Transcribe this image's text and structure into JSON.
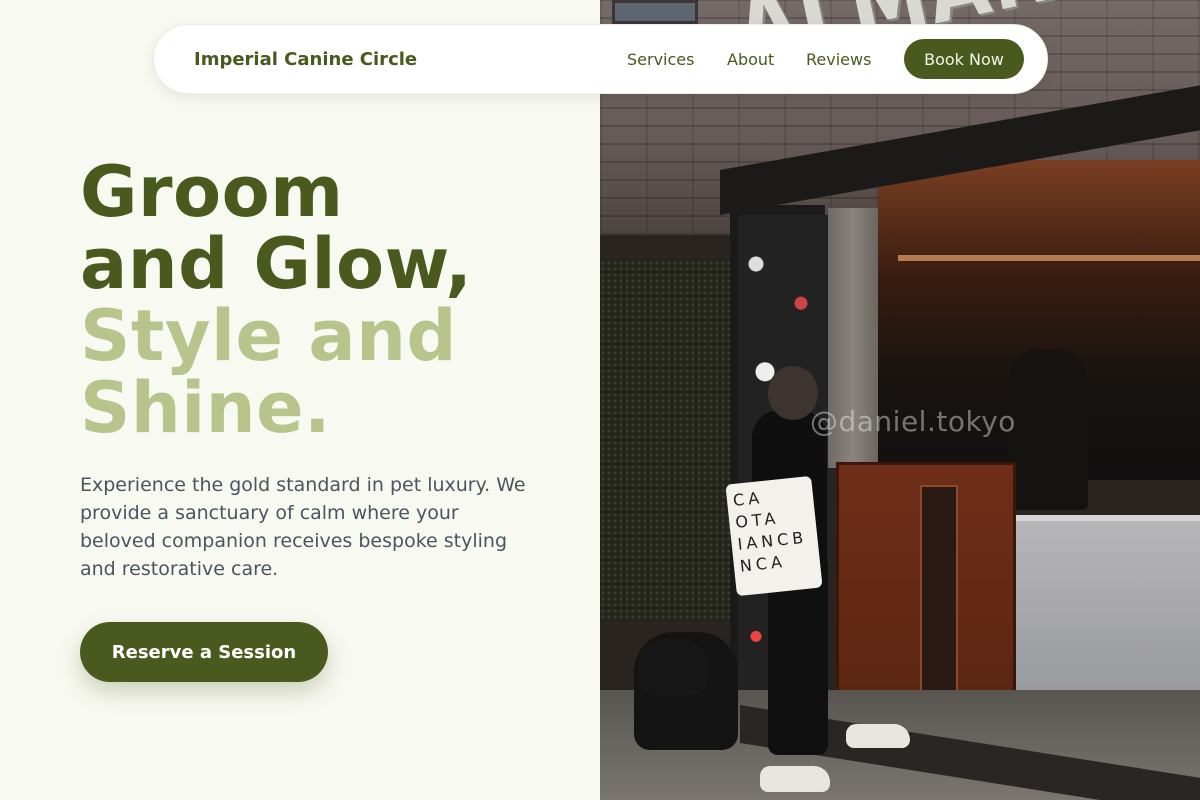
{
  "brand": {
    "name": "Imperial Canine Circle"
  },
  "nav": {
    "links": [
      {
        "label": "Services"
      },
      {
        "label": "About"
      },
      {
        "label": "Reviews"
      }
    ],
    "cta_label": "Book Now"
  },
  "hero": {
    "title_lines": [
      "Groom",
      "and Glow,",
      "Style and",
      "Shine."
    ],
    "description": "Experience the gold standard in pet luxury. We provide a sanctuary of calm where your beloved companion receives bespoke styling and restorative care.",
    "cta_label": "Reserve a Session"
  },
  "photo": {
    "sign_text": "ALMANEGRA",
    "watermark": "@daniel.tokyo",
    "tote_text": "CA OTA IANCB NCA"
  },
  "colors": {
    "primary": "#4a5a1e",
    "accent_light": "#b7c58d",
    "background": "#f8f9f1",
    "body_text": "#4a5560"
  }
}
